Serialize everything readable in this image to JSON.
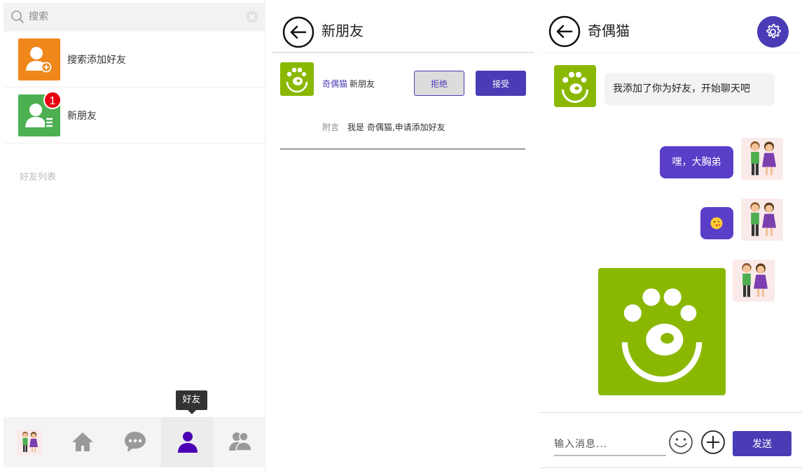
{
  "left": {
    "search": {
      "placeholder": "搜索"
    },
    "rows": [
      {
        "label": "搜索添加好友",
        "icon": "add-user-icon",
        "color": "#f0871a"
      },
      {
        "label": "新朋友",
        "icon": "new-friend-icon",
        "color": "#4caf50",
        "badge": "1"
      }
    ],
    "section_title": "好友列表",
    "tooltip": "好友",
    "tabs": [
      "avatar",
      "home-icon",
      "chat-icon",
      "friends-icon",
      "groups-icon"
    ],
    "active_tab": "friends-icon",
    "accent": "#4a00b4"
  },
  "middle": {
    "title": "新朋友",
    "request": {
      "name": "奇偶猫",
      "status": "新朋友",
      "reject_label": "拒绝",
      "accept_label": "接受",
      "note_label": "附言",
      "note_text": "我是 奇偶猫,申请添加好友"
    }
  },
  "right": {
    "title": "奇偶猫",
    "messages": [
      {
        "side": "left",
        "text": "我添加了你为好友，开始聊天吧"
      },
      {
        "side": "right",
        "text": "嘿，大胸弟"
      },
      {
        "side": "right",
        "type": "emoji",
        "emoji": "😘"
      },
      {
        "side": "right",
        "type": "image",
        "icon": "paw-logo"
      }
    ],
    "input": {
      "placeholder": "输入消息..."
    },
    "send_label": "发送",
    "accent": "#4a3cb5"
  }
}
